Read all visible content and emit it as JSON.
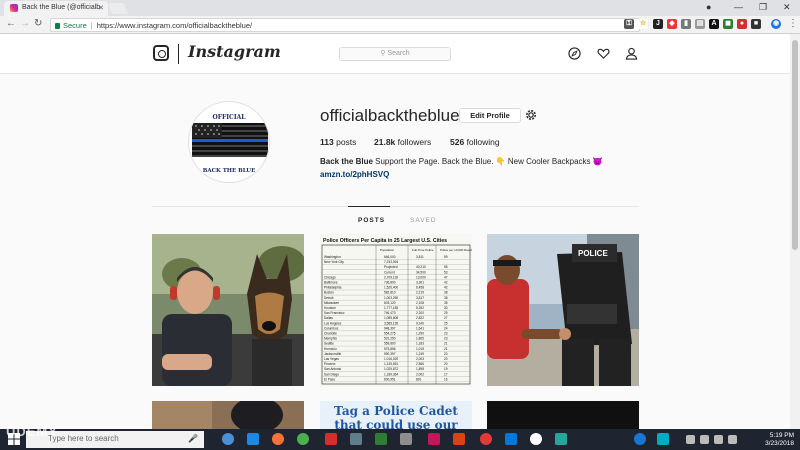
{
  "browser": {
    "tab_title": "Back the Blue (@officialb",
    "url_secure": "Secure",
    "url": "https://www.instagram.com/officialbacktheblue/"
  },
  "instagram": {
    "wordmark": "Instagram",
    "search_placeholder": "Search"
  },
  "profile": {
    "username": "officialbacktheblue",
    "edit_profile_label": "Edit Profile",
    "posts_count": "113",
    "posts_label": "posts",
    "followers_count": "21.8k",
    "followers_label": "followers",
    "following_count": "526",
    "following_label": "following",
    "bio_name": "Back the Blue",
    "bio_text": "Support the Page. Back the Blue. 👇 New Cooler Backpacks 😈",
    "bio_link": "amzn.to/2phHSVQ",
    "avatar_top_text": "OFFICIAL",
    "avatar_bottom_text": "BACK THE BLUE"
  },
  "tabs": [
    {
      "label": "POSTS",
      "active": true
    },
    {
      "label": "SAVED",
      "active": false
    }
  ],
  "posts": {
    "table_post_title": "Police Officers Per Capita in 25 Largest U.S. Cities",
    "table_columns": [
      "",
      "Population",
      "Full-Time Police",
      "Police per 10,000 Residents"
    ],
    "table_rows": [
      [
        "Washington",
        "646,000",
        "3,811",
        "59"
      ],
      [
        "New York City",
        "7,233,094",
        "",
        ""
      ],
      [
        "",
        "Projected",
        "40,210",
        "55"
      ],
      [
        "",
        "Current",
        "34,500",
        "53"
      ],
      [
        "Chicago",
        "2,709,118",
        "13,000",
        "47"
      ],
      [
        "Baltimore",
        "736,800",
        "3,301",
        "42"
      ],
      [
        "Philadelphia",
        "1,526,400",
        "6,458",
        "42"
      ],
      [
        "Boston",
        "582,810",
        "2,219",
        "38"
      ],
      [
        "Detroit",
        "1,003,250",
        "3,817",
        "38"
      ],
      [
        "Milwaukee",
        "603,120",
        "2,108",
        "35"
      ],
      [
        "Houston",
        "1,777,185",
        "5,252",
        "30"
      ],
      [
        "San Francisco",
        "746,473",
        "2,200",
        "29"
      ],
      [
        "Dallas",
        "1,085,608",
        "2,822",
        "27"
      ],
      [
        "Los Angeles",
        "3,585,135",
        "9,140",
        "25"
      ],
      [
        "Columbus",
        "948,397",
        "1,641",
        "24"
      ],
      [
        "Charlotte",
        "554,275",
        "1,290",
        "23"
      ],
      [
        "Memphis",
        "531,250",
        "1,805",
        "23"
      ],
      [
        "Seattle",
        "559,800",
        "1,183",
        "21"
      ],
      [
        "Honolulu",
        "575,856",
        "1,015",
        "21"
      ],
      [
        "Jacksonville",
        "590,397",
        "1,249",
        "20"
      ],
      [
        "Las Vegas",
        "1,016,020",
        "2,003",
        "20"
      ],
      [
        "Phoenix",
        "1,139,591",
        "2,566",
        "20"
      ],
      [
        "San Antonio",
        "1,025,872",
        "1,898",
        "19"
      ],
      [
        "San Diego",
        "1,189,364",
        "2,002",
        "17"
      ],
      [
        "El Paso",
        "600,951",
        "891",
        "16"
      ]
    ],
    "cadet_post_text": "Tag a Police Cadet that could use our Support!",
    "police_vest_text": "POLICE"
  },
  "taskbar": {
    "search_placeholder": "Type here to search",
    "time": "5:19 PM",
    "date": "3/23/2018"
  },
  "watermark": "UDEMY"
}
